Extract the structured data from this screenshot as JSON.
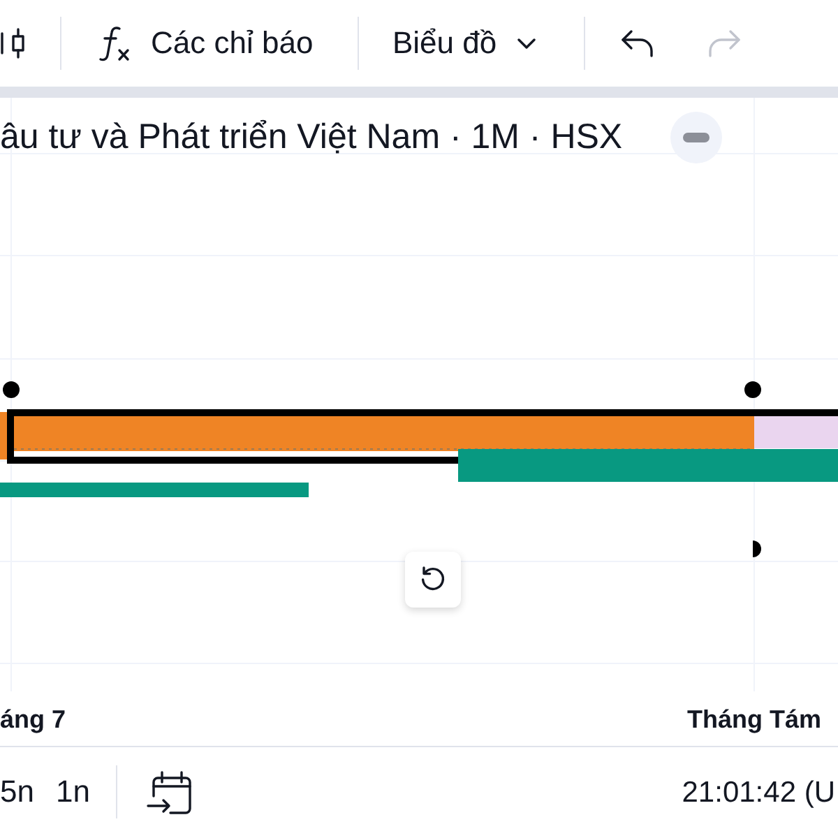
{
  "toolbar": {
    "indicators": {
      "label": "Các chỉ báo"
    },
    "chart_menu": {
      "label": "Biểu đồ"
    },
    "undo": {
      "disabled": false
    },
    "redo": {
      "disabled": true
    }
  },
  "legend": {
    "title": "âu tư và Phát triển Việt Nam · 1M · HSX"
  },
  "x_axis": {
    "labels": [
      "áng 7",
      "Tháng Tám"
    ]
  },
  "bottom_bar": {
    "ranges": [
      {
        "label": "5n",
        "selected": false
      },
      {
        "label": "1n",
        "selected": false
      }
    ],
    "time": "21:01:42 (U"
  }
}
